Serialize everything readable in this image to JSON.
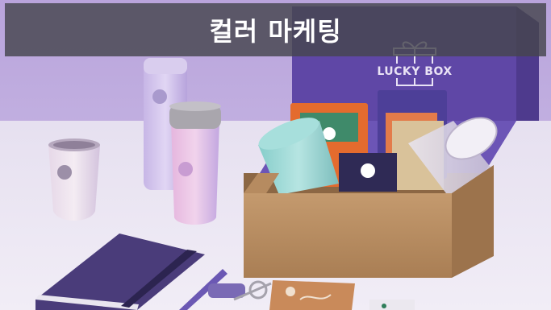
{
  "title": "컬러 마케팅",
  "box_label": "LUCKY BOX",
  "colors": {
    "background": "#c6b4e2",
    "table": "#e9e4f1",
    "box_kraft": "#b98e62",
    "box_lid_purple": "#6a4fb0",
    "tumbler_mint": "#9ad7d4",
    "notebook": "#4d3f7e",
    "title_bar": "#46464e"
  },
  "icons": {
    "gift": "gift-icon"
  }
}
